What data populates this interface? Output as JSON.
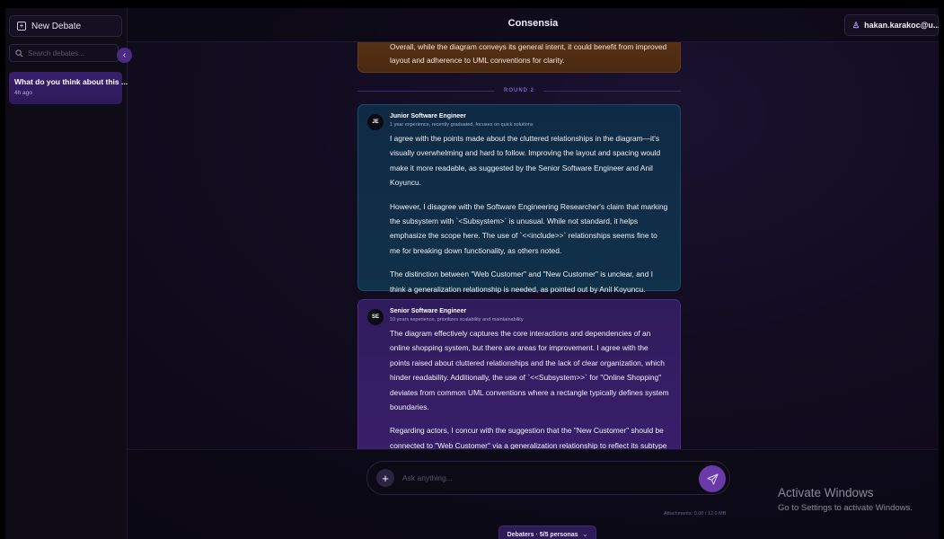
{
  "app": {
    "title": "Consensia"
  },
  "sidebar": {
    "new_debate_label": "New Debate",
    "search_placeholder": "Search debates...",
    "debates": [
      {
        "title": "What do you think about this ...",
        "time": "4h ago"
      }
    ]
  },
  "header": {
    "user": "hakan.karakoc@u..."
  },
  "conversation": {
    "previous_message": {
      "text": "Overall, while the diagram conveys its general intent, it could benefit from improved layout and adherence to UML conventions for clarity."
    },
    "round_label": "ROUND 2",
    "messages": [
      {
        "initials": "JE",
        "role": "Junior Software Engineer",
        "description": "1 year experience, recently graduated, focuses on quick solutions",
        "color": "#10314a",
        "paragraphs": [
          "I agree with the points made about the cluttered relationships in the diagram—it's visually overwhelming and hard to follow. Improving the layout and spacing would make it more readable, as suggested by the Senior Software Engineer and Anil Koyuncu.",
          "However, I disagree with the Software Engineering Researcher's claim that marking the subsystem with `<Subsystem>` is unusual. While not standard, it helps emphasize the scope here. The use of `<<include>>` relationships seems fine to me for breaking down functionality, as others noted.",
          "The distinction between \"Web Customer\" and \"New Customer\" is unclear, and I think a generalization relationship is needed, as pointed out by Anil Koyuncu."
        ]
      },
      {
        "initials": "SE",
        "role": "Senior Software Engineer",
        "description": "10 years experience, prioritizes scalability and maintainability",
        "color": "#3a1f6c",
        "paragraphs": [
          "The diagram effectively captures the core interactions and dependencies of an online shopping system, but there are areas for improvement. I agree with the points raised about cluttered relationships and the lack of clear organization, which hinder readability. Additionally, the use of `<<Subsystem>>` for \"Online Shopping\" deviates from common UML conventions where a rectangle typically defines system boundaries.",
          "Regarding actors, I concur with the suggestion that the \"New Customer\" should be connected to \"Web Customer\" via a generalization relationship to reflect its subtype nature. The `<<include>>` relationships are used correctly, but the diagram's overall layout could"
        ]
      }
    ]
  },
  "composer": {
    "placeholder": "Ask anything...",
    "attachments": "Attachments: 0.00 / 12.0 MB",
    "debaters_label": "Debaters · 5/5 personas"
  },
  "watermark": {
    "title": "Activate Windows",
    "subtitle": "Go to Settings to activate Windows."
  },
  "colors": {
    "accent": "#6a3aa8",
    "junior_bubble": "#10314a",
    "senior_bubble": "#3a1f6c",
    "previous_bubble": "#4a2a12"
  }
}
